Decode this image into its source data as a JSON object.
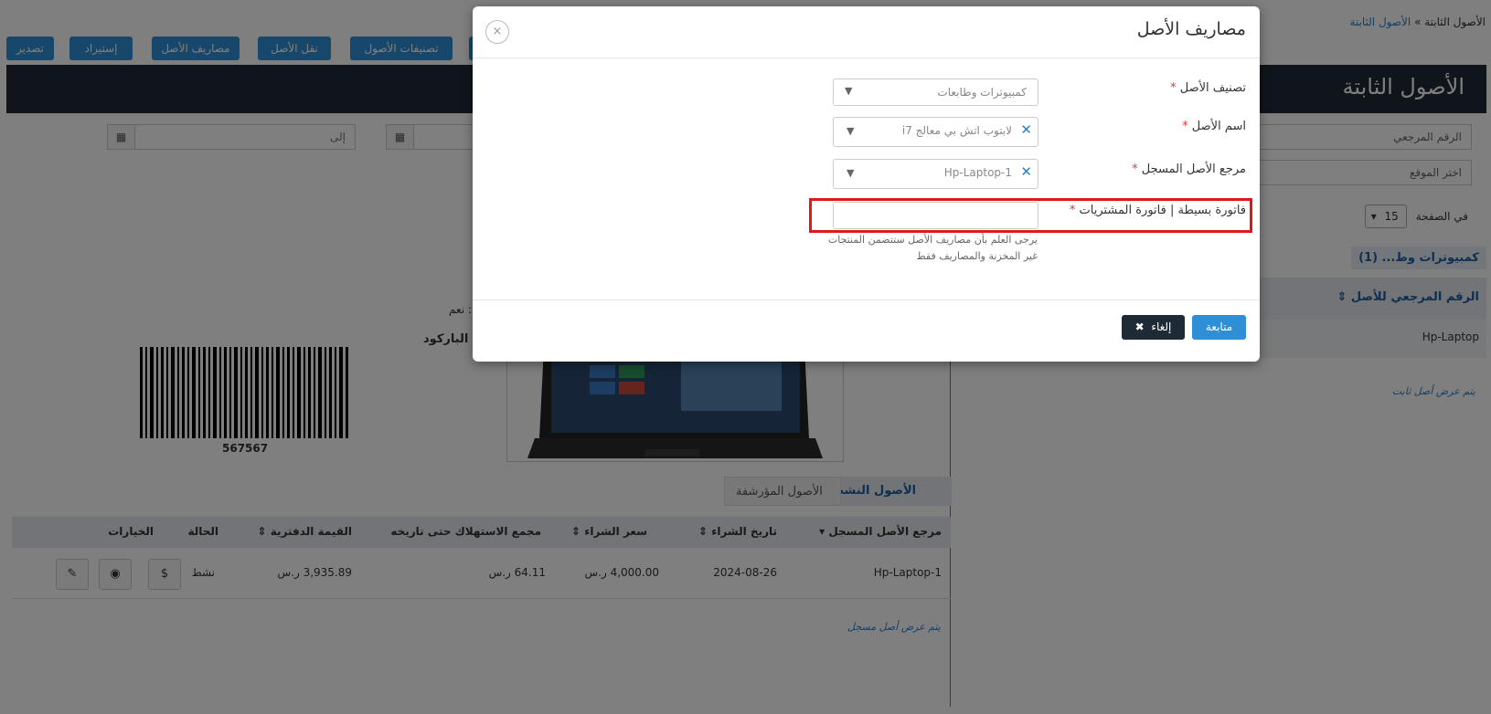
{
  "breadcrumb": {
    "parent": "الأصول الثابتة",
    "separator": "»",
    "current": "الأصول الثابتة"
  },
  "toolbar": {
    "buttons": [
      "تصدير",
      "إستيراد",
      "مصاريف الأصل",
      "نقل الأصل",
      "تصنيفات الأصول"
    ]
  },
  "page_title": "الأصول الثابتة",
  "filters": {
    "date_to_placeholder": "إلى",
    "reference_placeholder": "الرقم المرجعي",
    "location_placeholder": "اختر الموقع",
    "per_page_label": "في الصفحة",
    "per_page_value": "15"
  },
  "sidebar_list": {
    "category_tag": "كمبيوترات وط... (1)",
    "column_header": "الرقم المرجعي للأصل",
    "rows": [
      "Hp-Laptop"
    ],
    "footer_note": "يتم عرض أصل ثابت"
  },
  "details": {
    "yes_label": ": نعم",
    "barcode_label": "الباركود",
    "barcode_number": "567567"
  },
  "tabs": {
    "active": "الأصول النشطة",
    "archived": "الأصول المؤرشفة"
  },
  "table": {
    "headers": [
      "مرجع الأصل المسجل",
      "تاريخ الشراء",
      "سعر الشراء",
      "مجمع الاستهلاك حتى تاريخه",
      "القيمة الدفترية",
      "الحالة",
      "الخيارات"
    ],
    "row": {
      "ref": "Hp-Laptop-1",
      "date": "2024-08-26",
      "price": "4,000.00 ر.س",
      "depreciation": "64.11 ر.س",
      "book_value": "3,935.89 ر.س",
      "status": "نشط"
    },
    "footer_note": "يتم عرض أصل مسجل"
  },
  "modal": {
    "title": "مصاريف الأصل",
    "close_symbol": "×",
    "fields": {
      "category_label": "تصنيف الأصل",
      "category_value": "كمبيوترات وطابعات",
      "name_label": "اسم الأصل",
      "name_value": "لابتوب اتش بي معالج i7",
      "ref_label": "مرجع الأصل المسجل",
      "ref_value": "Hp-Laptop-1",
      "invoice_label": "فاتورة بسيطة | فاتورة المشتريات",
      "invoice_value": "",
      "help_text": "يرجى العلم بأن مصاريف الأصل ستتضمن المنتجات غير المخزنة والمصاريف فقط"
    },
    "required_mark": "*",
    "continue_label": "متابعة",
    "cancel_label": "إلغاء"
  },
  "colors": {
    "primary": "#2f8fd6",
    "dark": "#1e2a36",
    "highlight": "#e01818",
    "required": "#e53935"
  }
}
